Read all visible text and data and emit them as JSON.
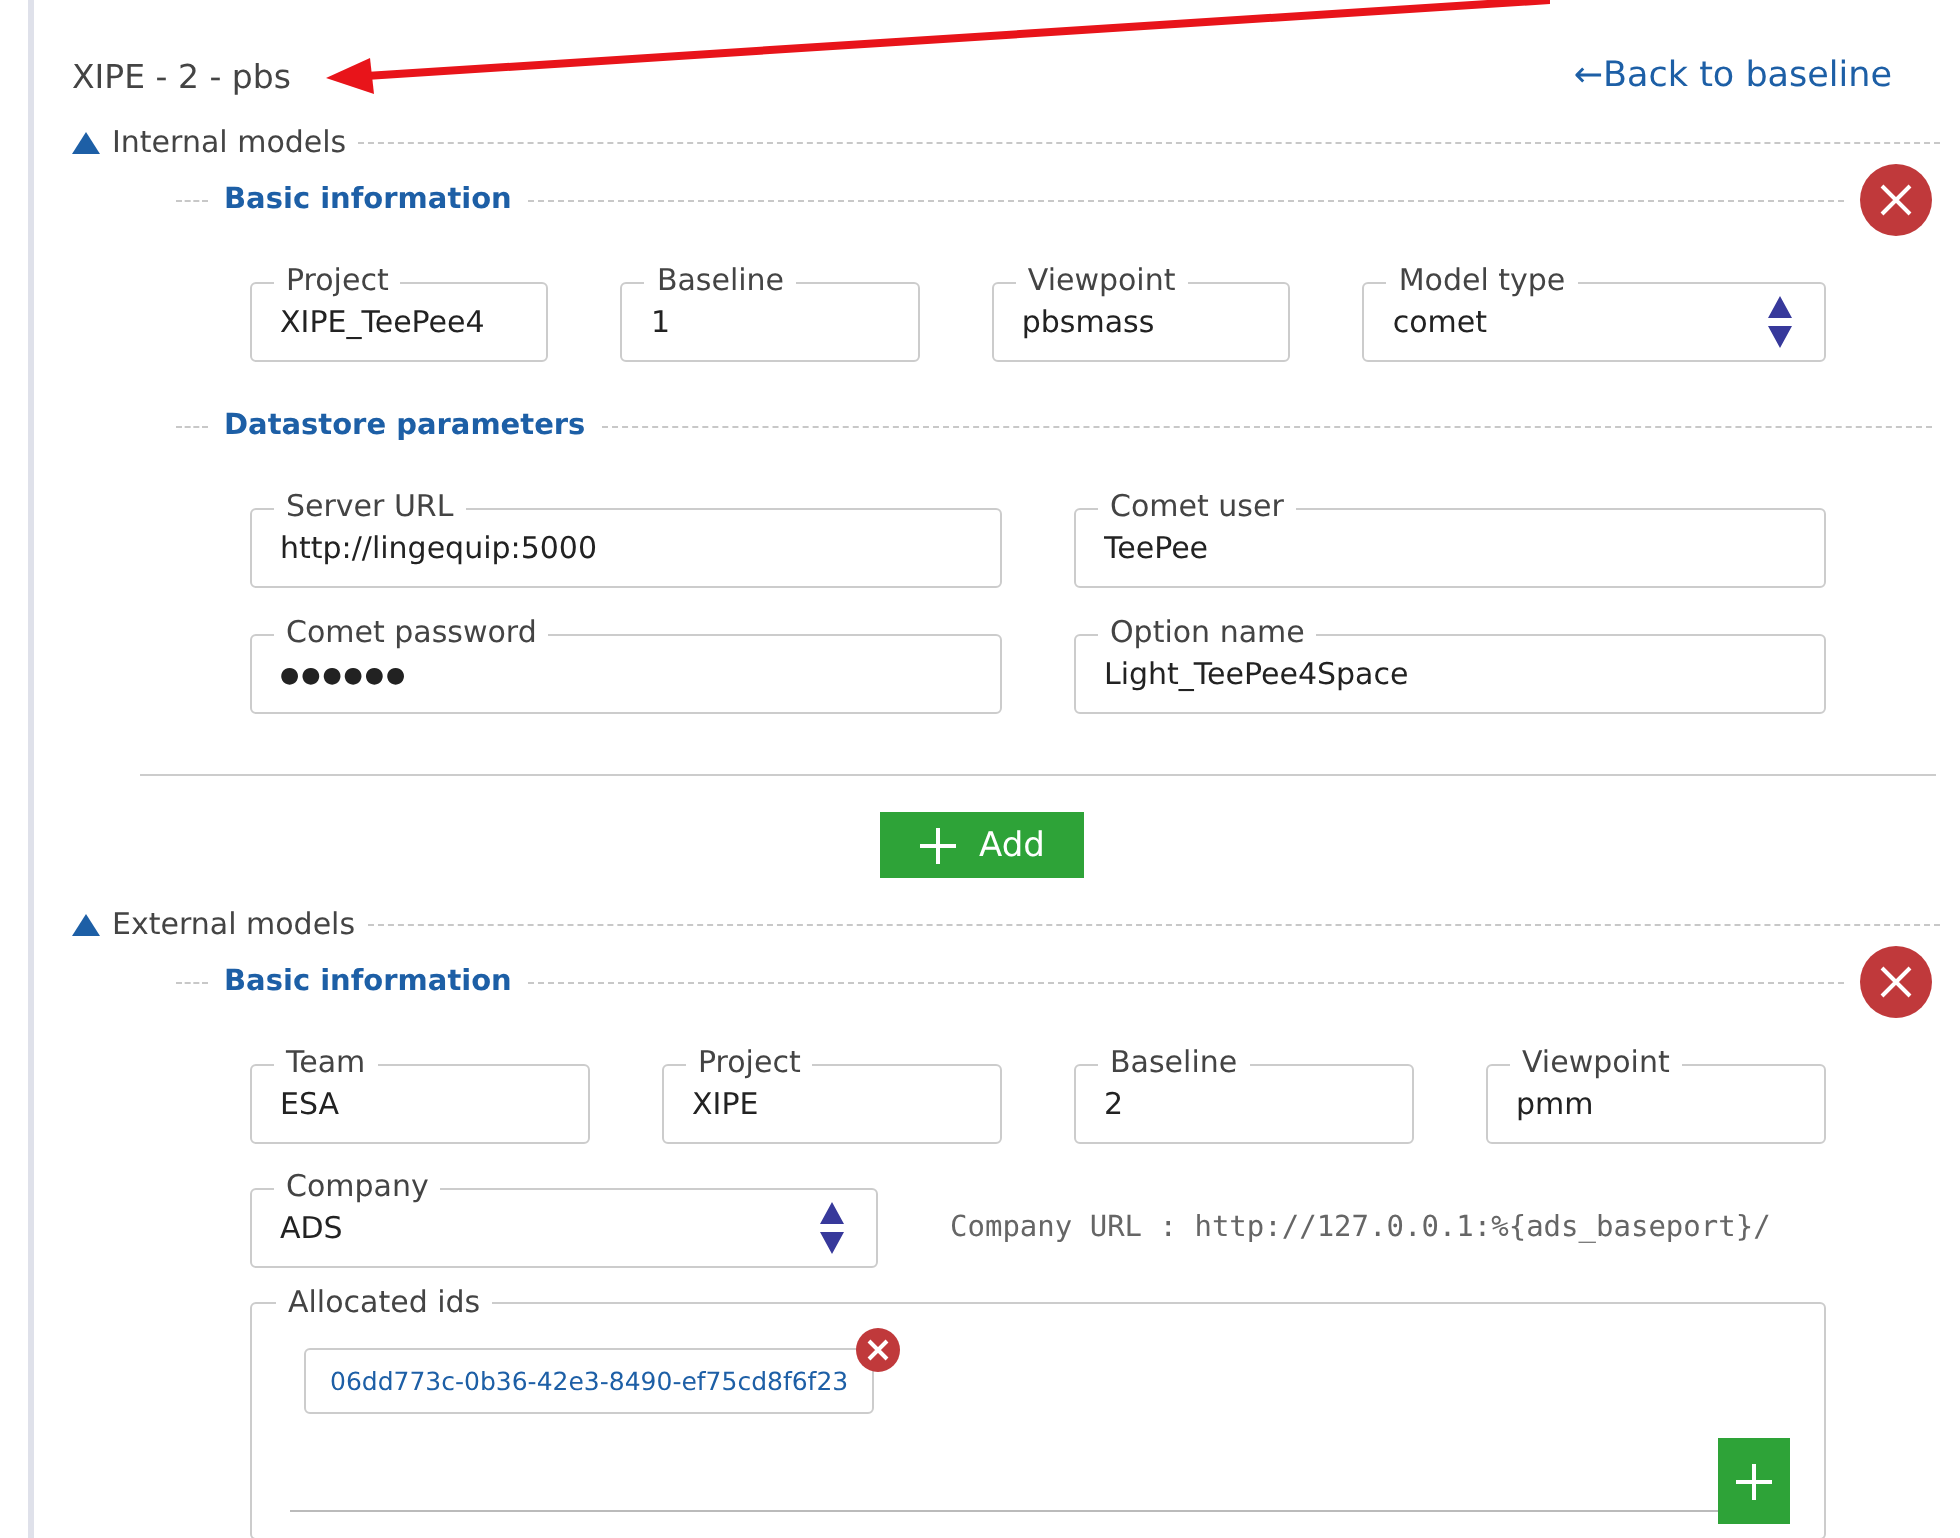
{
  "page_title": "XIPE - 2 - pbs",
  "back_link": "←Back to baseline",
  "sections": [
    {
      "title": "Internal models",
      "expanded": true,
      "add_label": "Add",
      "groups": [
        {
          "title": "Basic information",
          "removable": true,
          "rows": [
            [
              {
                "label": "Project",
                "value": "XIPE_TeePee4",
                "kind": "text"
              },
              {
                "label": "Baseline",
                "value": "1",
                "kind": "text"
              },
              {
                "label": "Viewpoint",
                "value": "pbsmass",
                "kind": "text"
              },
              {
                "label": "Model type",
                "value": "comet",
                "kind": "select"
              }
            ]
          ]
        },
        {
          "title": "Datastore parameters",
          "removable": false,
          "rows": [
            [
              {
                "label": "Server URL",
                "value": "http://lingequip:5000",
                "kind": "text"
              },
              {
                "label": "Comet user",
                "value": "TeePee",
                "kind": "text"
              }
            ],
            [
              {
                "label": "Comet password",
                "value": "●●●●●●",
                "kind": "password"
              },
              {
                "label": "Option name",
                "value": "Light_TeePee4Space",
                "kind": "text"
              }
            ]
          ]
        }
      ]
    },
    {
      "title": "External models",
      "expanded": true,
      "groups": [
        {
          "title": "Basic information",
          "removable": true,
          "rows": [
            [
              {
                "label": "Team",
                "value": "ESA",
                "kind": "text"
              },
              {
                "label": "Project",
                "value": "XIPE",
                "kind": "text"
              },
              {
                "label": "Baseline",
                "value": "2",
                "kind": "text"
              },
              {
                "label": "Viewpoint",
                "value": "pmm",
                "kind": "text"
              }
            ]
          ],
          "company": {
            "label": "Company",
            "value": "ADS",
            "kind": "select"
          },
          "company_url": "Company URL : http://127.0.0.1:%{ads_baseport}/",
          "allocated_ids": {
            "label": "Allocated ids",
            "ids": [
              "06dd773c-0b36-42e3-8490-ef75cd8f6f23"
            ]
          }
        }
      ]
    }
  ]
}
